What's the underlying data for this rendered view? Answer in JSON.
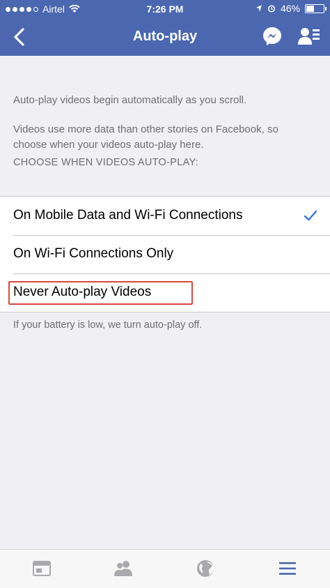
{
  "status_bar": {
    "carrier": "Airtel",
    "time": "7:26 PM",
    "battery": "46%",
    "battery_level": 0.46
  },
  "nav": {
    "title": "Auto-play",
    "icons": [
      "back-chevron-icon",
      "messenger-icon",
      "profile-icon"
    ]
  },
  "description": {
    "line1": "Auto-play videos begin automatically as you scroll.",
    "line2a": "Videos use more data than other stories on Facebook, so",
    "line2b": "choose when your videos auto-play here."
  },
  "section_header": "CHOOSE WHEN VIDEOS AUTO-PLAY:",
  "options": [
    {
      "label": "On Mobile Data and Wi-Fi Connections",
      "selected": true
    },
    {
      "label": "On Wi-Fi Connections Only",
      "selected": false
    },
    {
      "label": "Never Auto-play Videos",
      "selected": false
    }
  ],
  "footer_note": "If your battery is low, we turn auto-play off.",
  "colors": {
    "nav_bar": "#4a67b0",
    "check": "#3b75d6",
    "highlight": "#d9473e",
    "tab_active": "#4a67b0",
    "tab_inactive": "#a8a8ad"
  },
  "tab_bar": {
    "icons": [
      "news-feed-icon",
      "friends-icon",
      "globe-icon",
      "menu-icon"
    ],
    "active": "menu-icon"
  }
}
